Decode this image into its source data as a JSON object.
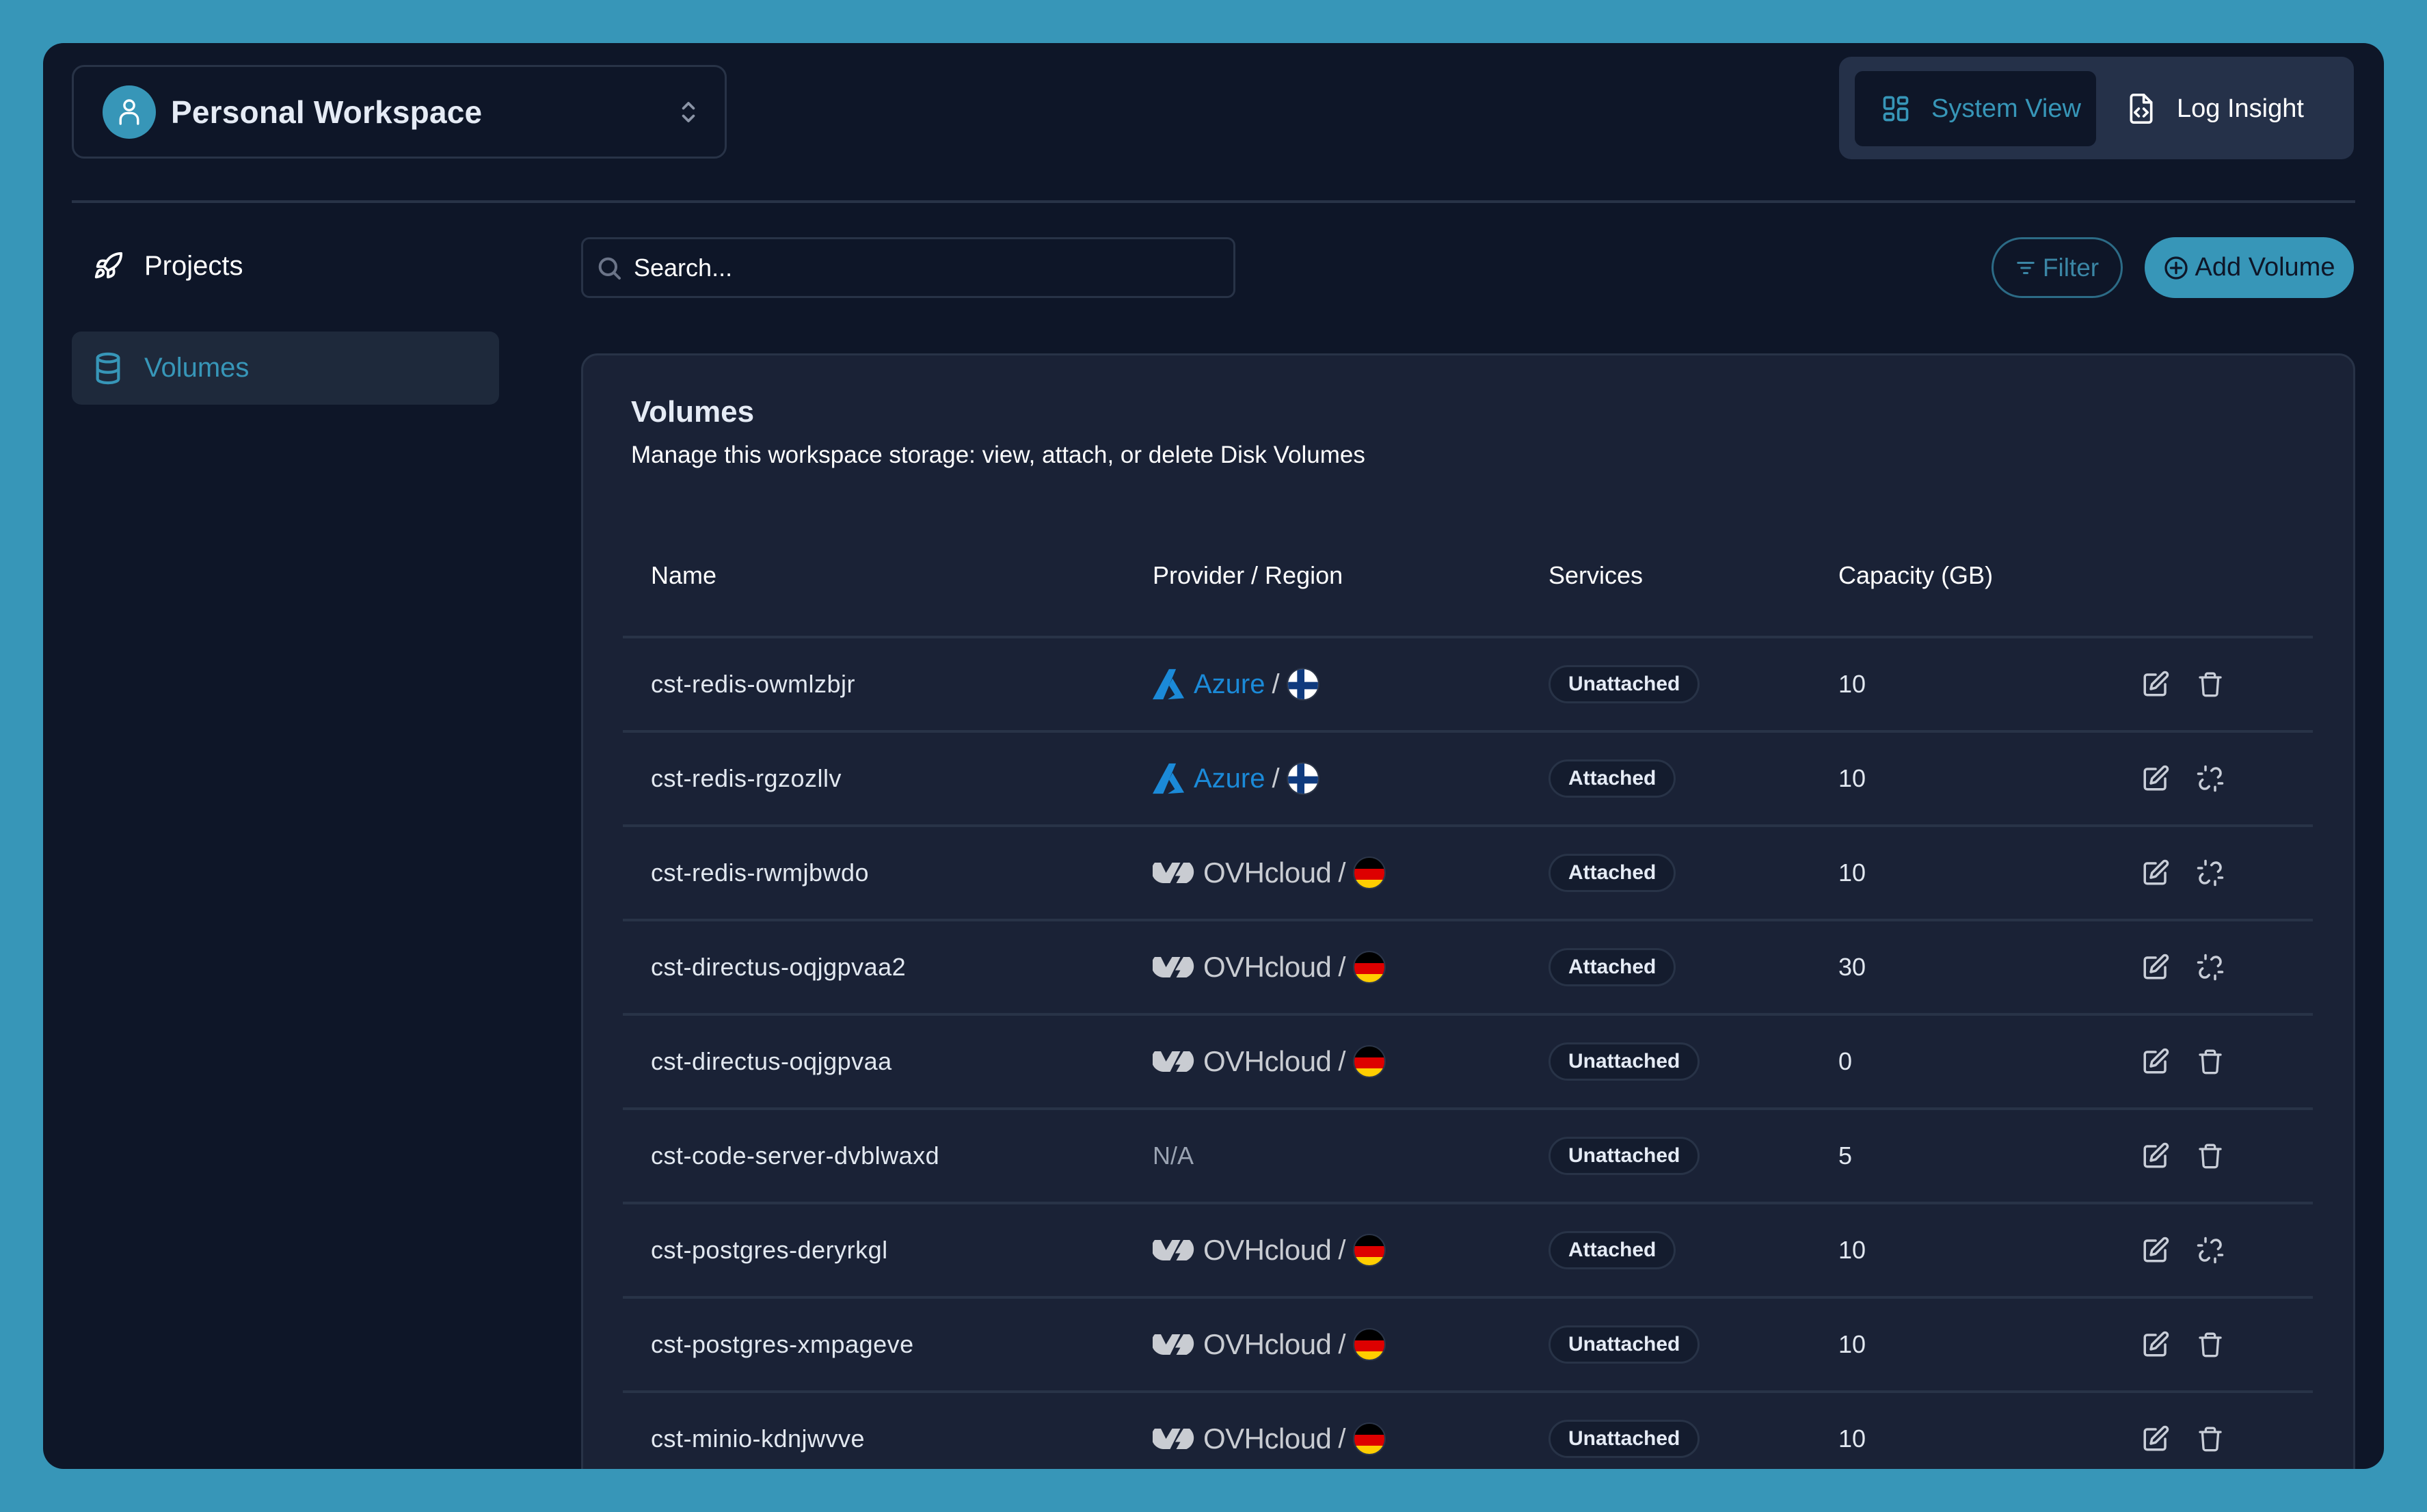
{
  "workspace": {
    "name": "Personal Workspace",
    "avatar_icon": "user-icon",
    "chevron_icon": "chevron-up-down-icon"
  },
  "view_toggle": {
    "options": [
      {
        "label": "System View",
        "icon": "grid-icon",
        "active": true
      },
      {
        "label": "Log Insight",
        "icon": "file-code-icon",
        "active": false
      }
    ]
  },
  "sidebar": {
    "items": [
      {
        "label": "Projects",
        "icon": "rocket-icon",
        "active": false
      },
      {
        "label": "Volumes",
        "icon": "database-icon",
        "active": true
      }
    ]
  },
  "toolbar": {
    "search_placeholder": "Search...",
    "filter_label": "Filter",
    "add_label": "Add Volume"
  },
  "colors": {
    "accent": "#3796b8",
    "window_bg": "#0e1628",
    "panel_bg": "#1a2236",
    "azure": "#1b8ad8"
  },
  "panel": {
    "title": "Volumes",
    "subtitle": "Manage this workspace storage: view, attach, or delete Disk Volumes"
  },
  "table": {
    "columns": [
      "Name",
      "Provider / Region",
      "Services",
      "Capacity (GB)"
    ],
    "rows": [
      {
        "name": "cst-redis-owmlzbjr",
        "provider": "Azure",
        "region": "Finland",
        "service": "Unattached",
        "capacity": "10",
        "action2": "delete"
      },
      {
        "name": "cst-redis-rgzozllv",
        "provider": "Azure",
        "region": "Finland",
        "service": "Attached",
        "capacity": "10",
        "action2": "detach"
      },
      {
        "name": "cst-redis-rwmjbwdo",
        "provider": "OVHcloud",
        "region": "Germany",
        "service": "Attached",
        "capacity": "10",
        "action2": "detach"
      },
      {
        "name": "cst-directus-oqjgpvaa2",
        "provider": "OVHcloud",
        "region": "Germany",
        "service": "Attached",
        "capacity": "30",
        "action2": "detach"
      },
      {
        "name": "cst-directus-oqjgpvaa",
        "provider": "OVHcloud",
        "region": "Germany",
        "service": "Unattached",
        "capacity": "0",
        "action2": "delete"
      },
      {
        "name": "cst-code-server-dvblwaxd",
        "provider": "N/A",
        "region": "",
        "service": "Unattached",
        "capacity": "5",
        "action2": "delete"
      },
      {
        "name": "cst-postgres-deryrkgl",
        "provider": "OVHcloud",
        "region": "Germany",
        "service": "Attached",
        "capacity": "10",
        "action2": "detach"
      },
      {
        "name": "cst-postgres-xmpageve",
        "provider": "OVHcloud",
        "region": "Germany",
        "service": "Unattached",
        "capacity": "10",
        "action2": "delete"
      },
      {
        "name": "cst-minio-kdnjwvve",
        "provider": "OVHcloud",
        "region": "Germany",
        "service": "Unattached",
        "capacity": "10",
        "action2": "delete"
      }
    ]
  }
}
